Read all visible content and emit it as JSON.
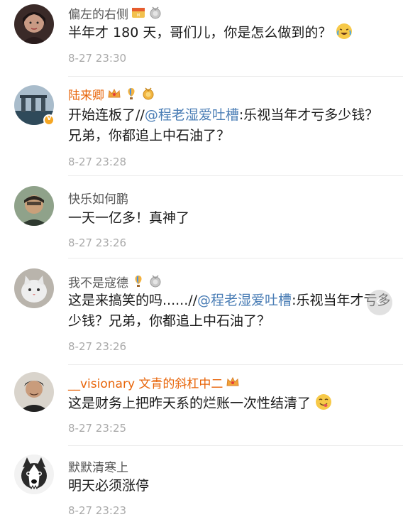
{
  "comments": [
    {
      "user": "偏左的右侧",
      "badges": [
        "movie-badge",
        "silver-medal-badge"
      ],
      "text": "半年才 180 天，哥们儿，你是怎么做到的？",
      "emoji": "crying-laughing-emoji",
      "time": "8-27 23:30"
    },
    {
      "user": "陆来卿",
      "verified": true,
      "badges": [
        "crown-badge",
        "balloon-badge",
        "gold-medal-badge"
      ],
      "text_prefix": "开始连板了//",
      "mention": "@程老湿爱吐槽",
      "text_suffix": ":乐视当年才亏多少钱？兄弟，你都追上中石油了？",
      "time": "8-27 23:28"
    },
    {
      "user": "快乐如何鹏",
      "text": "一天一亿多！真神了",
      "time": "8-27 23:26"
    },
    {
      "user": "我不是寇德",
      "badges": [
        "balloon-badge",
        "silver-medal-badge"
      ],
      "text_prefix": "这是来搞笑的吗......//",
      "mention": "@程老湿爱吐槽",
      "text_suffix": ":乐视当年才亏多少钱？兄弟，你都追上中石油了？",
      "time": "8-27 23:26"
    },
    {
      "user": "__visionary 文青的斜杠中二",
      "badges": [
        "crown-badge"
      ],
      "text": "这是财务上把昨天系的烂账一次性结清了",
      "emoji": "yum-emoji",
      "time": "8-27 23:25"
    },
    {
      "user": "默默清寒上",
      "text": "明天必须涨停",
      "time": "8-27 23:23"
    }
  ],
  "colors": {
    "username": "#555555",
    "vip_username": "#e8650a",
    "text": "#1a1a1a",
    "mention": "#4a7db5",
    "timestamp": "#aaaaaa",
    "divider": "#ebebeb"
  }
}
